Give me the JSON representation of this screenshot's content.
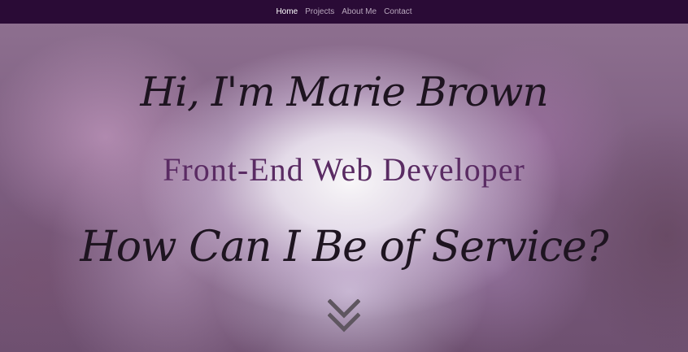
{
  "nav": {
    "items": [
      {
        "label": "Home",
        "active": true
      },
      {
        "label": "Projects",
        "active": false
      },
      {
        "label": "About Me",
        "active": false
      },
      {
        "label": "Contact",
        "active": false
      }
    ]
  },
  "hero": {
    "greeting": "Hi, I'm Marie Brown",
    "role": "Front-End Web Developer",
    "tagline": "How Can I Be of Service?",
    "scroll_icon": "double-chevron-down-icon"
  },
  "colors": {
    "navbar_bg": "#2a0b36",
    "nav_text": "#b9a8be",
    "nav_active": "#ffffff",
    "heading_text": "#1e1420",
    "role_text": "#5a2b63",
    "chevron": "#5f5660"
  }
}
